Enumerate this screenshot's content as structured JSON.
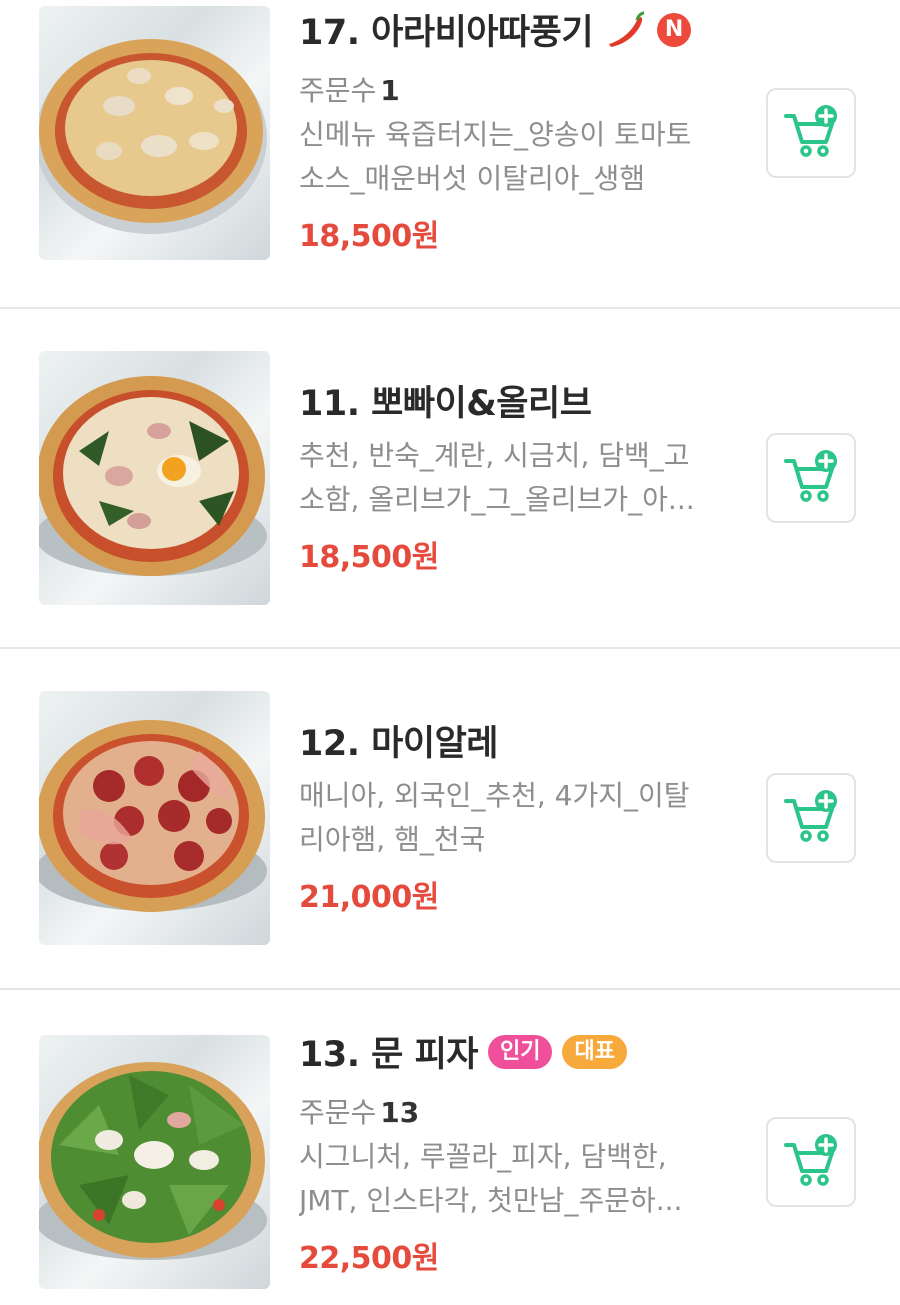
{
  "menu": {
    "items": [
      {
        "title": "17. 아라비아따풍기",
        "orders_label": "주문수",
        "orders_count": "1",
        "desc_line1": "신메뉴 육즙터지는_양송이 토마토",
        "desc_line2": "소스_매운버섯 이탈리아_생햄",
        "price": "18,500원",
        "new_badge": "N",
        "icons": [
          "pepper-icon",
          "cart-add-icon"
        ]
      },
      {
        "title": "11. 뽀빠이&올리브",
        "desc_line1": "추천, 반숙_계란, 시금치, 담백_고",
        "desc_line2": "소함, 올리브가_그_올리브가_아...",
        "price": "18,500원",
        "icons": [
          "cart-add-icon"
        ]
      },
      {
        "title": "12. 마이알레",
        "desc_line1": "매니아, 외국인_추천, 4가지_이탈",
        "desc_line2": "리아햄, 햄_천국",
        "price": "21,000원",
        "icons": [
          "cart-add-icon"
        ]
      },
      {
        "title": "13. 문 피자",
        "badge_popular": "인기",
        "badge_signature": "대표",
        "orders_label": "주문수",
        "orders_count": "13",
        "desc_line1": "시그니처, 루꼴라_피자, 담백한,",
        "desc_line2": "JMT, 인스타각, 첫만남_주문하...",
        "price": "22,500원",
        "icons": [
          "cart-add-icon"
        ]
      }
    ]
  },
  "colors": {
    "price": "#e54b3c",
    "cart_icon": "#2bc48a",
    "badge_popular": "#f0509b",
    "badge_signature": "#f7a93b",
    "new_badge": "#ee4a3b"
  }
}
